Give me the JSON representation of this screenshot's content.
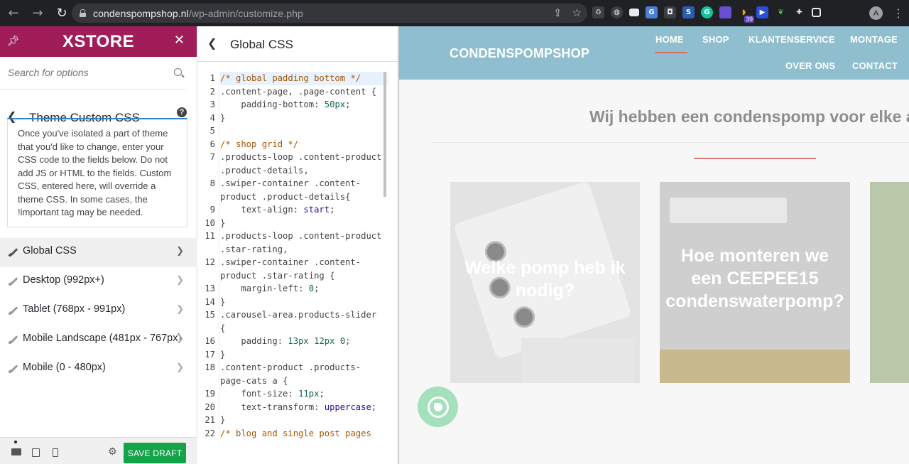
{
  "browser": {
    "url_domain": "condenspompshop.nl",
    "url_path": "/wp-admin/customize.php",
    "ext_badge": "39",
    "avatar_letter": "A"
  },
  "customizer": {
    "brand": "XSTORE",
    "search_placeholder": "Search for options",
    "section_title": "Theme Custom CSS",
    "description": "Once you've isolated a part of theme that you'd like to change, enter your CSS code to the fields below. Do not add JS or HTML to the fields. Custom CSS, entered here, will override a theme CSS. In some cases, the !important tag may be needed.",
    "menu": [
      {
        "label": "Global CSS",
        "active": true
      },
      {
        "label": "Desktop (992px+)",
        "active": false
      },
      {
        "label": "Tablet (768px - 991px)",
        "active": false
      },
      {
        "label": "Mobile Landscape (481px - 767px)",
        "active": false
      },
      {
        "label": "Mobile (0 - 480px)",
        "active": false
      }
    ],
    "save_label": "SAVE DRAFT"
  },
  "code_panel": {
    "title": "Global CSS",
    "lines": [
      {
        "n": "1",
        "html": "<span class=\"cm-comment\">/* global padding bottom */</span>"
      },
      {
        "n": "2",
        "html": ".content-page, .page-content {"
      },
      {
        "n": "3",
        "html": "    padding-bottom: <span class=\"cm-num\">50px</span>;"
      },
      {
        "n": "4",
        "html": "}"
      },
      {
        "n": "5",
        "html": ""
      },
      {
        "n": "6",
        "html": "<span class=\"cm-comment\">/* shop grid */</span>"
      },
      {
        "n": "7",
        "html": ".products-loop .content-product\n.product-details,"
      },
      {
        "n": "8",
        "html": ".swiper-container .content-\nproduct .product-details{"
      },
      {
        "n": "9",
        "html": "    text-align: <span class=\"cm-kw\">start</span>;"
      },
      {
        "n": "10",
        "html": "}"
      },
      {
        "n": "11",
        "html": ".products-loop .content-product\n.star-rating,"
      },
      {
        "n": "12",
        "html": ".swiper-container .content-\nproduct .star-rating {"
      },
      {
        "n": "13",
        "html": "    margin-left: <span class=\"cm-num\">0</span>;"
      },
      {
        "n": "14",
        "html": "}"
      },
      {
        "n": "15",
        "html": ".carousel-area.products-slider\n{"
      },
      {
        "n": "16",
        "html": "    padding: <span class=\"cm-num\">13px</span> <span class=\"cm-num\">12px</span> <span class=\"cm-num\">0</span>;"
      },
      {
        "n": "17",
        "html": "}"
      },
      {
        "n": "18",
        "html": ".content-product .products-\npage-cats a {"
      },
      {
        "n": "19",
        "html": "    font-size: <span class=\"cm-num\">11px</span>;"
      },
      {
        "n": "20",
        "html": "    text-transform: <span class=\"cm-kw\">uppercase</span>;"
      },
      {
        "n": "21",
        "html": "}"
      },
      {
        "n": "22",
        "html": "<span class=\"cm-comment\">/* blog and single post pages</span>"
      }
    ]
  },
  "preview": {
    "site_logo": "CONDENSPOMPSHOP",
    "nav": [
      "HOME",
      "SHOP",
      "KLANTENSERVICE",
      "MONTAGE",
      "OVER ONS",
      "CONTACT"
    ],
    "heading": "Wij hebben een condenspomp voor elke airco",
    "cards": [
      {
        "title": "Welke pomp heb ik nodig?"
      },
      {
        "title": "Hoe monteren we een CEEPEE15 condenswaterpomp?"
      }
    ]
  }
}
